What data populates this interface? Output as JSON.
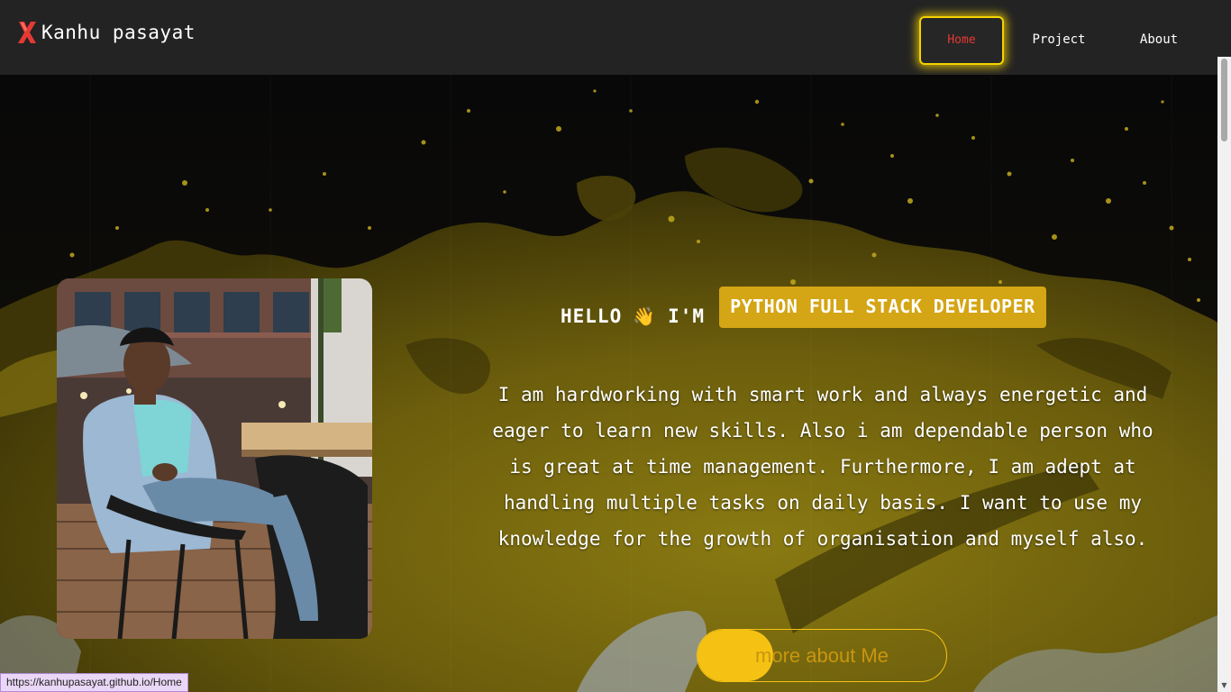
{
  "brand": {
    "name": "Kanhu pasayat",
    "logo_icon": "x-icon",
    "logo_color": "#e53935"
  },
  "nav": {
    "items": [
      {
        "label": "Home",
        "active": true
      },
      {
        "label": "Project",
        "active": false
      },
      {
        "label": "About",
        "active": false
      }
    ]
  },
  "hero": {
    "greeting": "HELLO",
    "wave": "👋",
    "im": "I'M",
    "role": "PYTHON FULL STACK DEVELOPER",
    "description": "I am hardworking with smart work and always energetic and eager to learn new skills. Also i am dependable person who is great at time management. Furthermore, I am adept at handling multiple tasks on daily basis. I want to use my knowledge for the growth of organisation and myself also.",
    "cta_label": "more about Me",
    "photo_icon": "profile-photo"
  },
  "status": {
    "url": "https://kanhupasayat.github.io/Home"
  },
  "colors": {
    "accent": "#f5c214",
    "badge": "#d4a514",
    "active_link": "#e53935",
    "navbar": "#232323"
  }
}
